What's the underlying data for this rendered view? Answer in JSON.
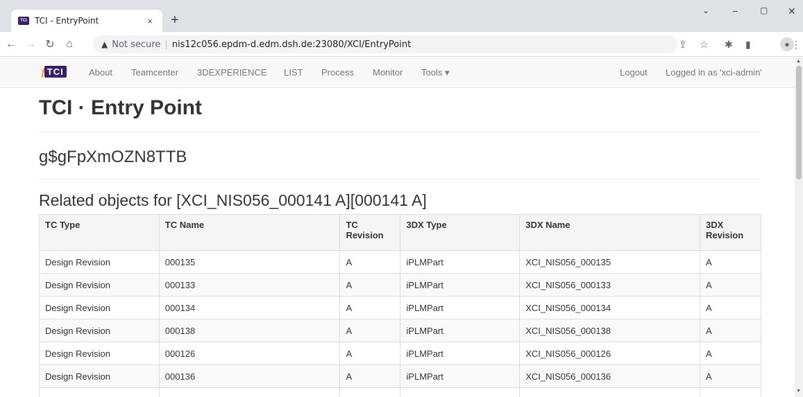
{
  "browser": {
    "tab_title": "TCI - EntryPoint",
    "favicon_text": "TCI",
    "new_tab": "+",
    "close_tab": "×",
    "win_minimize": "−",
    "win_maximize": "▢",
    "win_close": "✕",
    "win_dropdown": "⌄",
    "security_icon": "▲",
    "security_text": "Not secure",
    "url": "nis12c056.epdm-d.edm.dsh.de:23080/XCI/EntryPoint"
  },
  "navbar": {
    "brand": "TCI",
    "links": [
      "About",
      "Teamcenter",
      "3DEXPERIENCE",
      "LIST",
      "Process",
      "Monitor",
      "Tools ▾"
    ],
    "logout": "Logout",
    "logged_in": "Logged in as 'xci-admin'"
  },
  "page": {
    "title_bold": "TCI",
    "title_rest": " · Entry Point",
    "id": "g$gFpXmOZN8TTB",
    "related_heading": "Related objects for [XCI_NIS056_000141 A][000141 A]"
  },
  "table": {
    "headers": [
      "TC Type",
      "TC Name",
      "TC Revision",
      "3DX Type",
      "3DX Name",
      "3DX Revision"
    ],
    "rows": [
      [
        "Design Revision",
        "000135",
        "A",
        "iPLMPart",
        "XCI_NIS056_000135",
        "A"
      ],
      [
        "Design Revision",
        "000133",
        "A",
        "iPLMPart",
        "XCI_NIS056_000133",
        "A"
      ],
      [
        "Design Revision",
        "000134",
        "A",
        "iPLMPart",
        "XCI_NIS056_000134",
        "A"
      ],
      [
        "Design Revision",
        "000138",
        "A",
        "iPLMPart",
        "XCI_NIS056_000138",
        "A"
      ],
      [
        "Design Revision",
        "000126",
        "A",
        "iPLMPart",
        "XCI_NIS056_000126",
        "A"
      ],
      [
        "Design Revision",
        "000136",
        "A",
        "iPLMPart",
        "XCI_NIS056_000136",
        "A"
      ],
      [
        "",
        "",
        "",
        "",
        "",
        ""
      ]
    ]
  }
}
